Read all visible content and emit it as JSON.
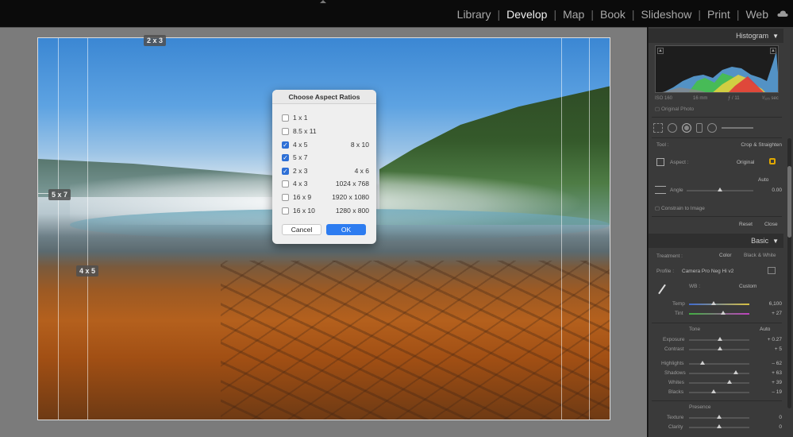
{
  "nav": {
    "modules": [
      "Library",
      "Develop",
      "Map",
      "Book",
      "Slideshow",
      "Print",
      "Web"
    ],
    "active": "Develop"
  },
  "canvas": {
    "ratio_tags": [
      "2 x 3",
      "5 x 7",
      "4 x 5"
    ]
  },
  "dialog": {
    "title": "Choose Aspect Ratios",
    "options": [
      {
        "a": "1 x 1",
        "b": "",
        "checked": false
      },
      {
        "a": "8.5 x 11",
        "b": "",
        "checked": false
      },
      {
        "a": "4 x 5",
        "b": "8 x 10",
        "checked": true
      },
      {
        "a": "5 x 7",
        "b": "",
        "checked": true
      },
      {
        "a": "2 x 3",
        "b": "4 x 6",
        "checked": true
      },
      {
        "a": "4 x 3",
        "b": "1024 x 768",
        "checked": false
      },
      {
        "a": "16 x 9",
        "b": "1920 x 1080",
        "checked": false
      },
      {
        "a": "16 x 10",
        "b": "1280 x 800",
        "checked": false
      }
    ],
    "cancel": "Cancel",
    "ok": "OK"
  },
  "panel": {
    "histogram": {
      "title": "Histogram"
    },
    "meta": {
      "iso": "ISO 160",
      "focal": "16 mm",
      "aperture": "ƒ / 11",
      "shutter": "¹⁄₁₂₅ sec"
    },
    "original_photo": "Original Photo",
    "crop": {
      "tool_label": "Tool :",
      "tool_value": "Crop & Straighten",
      "aspect_label": "Aspect :",
      "aspect_value": "Original",
      "auto": "Auto",
      "angle_label": "Angle",
      "angle_value": "0.00",
      "constrain": "Constrain to Image",
      "reset": "Reset",
      "close": "Close"
    },
    "basic": {
      "title": "Basic",
      "treatment_label": "Treatment :",
      "color": "Color",
      "bw": "Black & White",
      "profile_label": "Profile :",
      "profile_value": "Camera Pro Neg Hi v2",
      "wb_label": "WB :",
      "wb_value": "Custom",
      "temp_label": "Temp",
      "temp_value": "6,100",
      "tint_label": "Tint",
      "tint_value": "+ 27",
      "tone_label": "Tone",
      "tone_auto": "Auto",
      "exposure_label": "Exposure",
      "exposure_value": "+ 0.27",
      "contrast_label": "Contrast",
      "contrast_value": "+ 5",
      "highlights_label": "Highlights",
      "highlights_value": "– 62",
      "shadows_label": "Shadows",
      "shadows_value": "+ 63",
      "whites_label": "Whites",
      "whites_value": "+ 39",
      "blacks_label": "Blacks",
      "blacks_value": "– 19",
      "presence_label": "Presence",
      "texture_label": "Texture",
      "texture_value": "0",
      "clarity_label": "Clarity",
      "clarity_value": "0"
    }
  },
  "colors": {
    "accent": "#2d7cf0",
    "panel_bg": "#3a3a3a",
    "canvas_bg": "#7b7b7b"
  }
}
